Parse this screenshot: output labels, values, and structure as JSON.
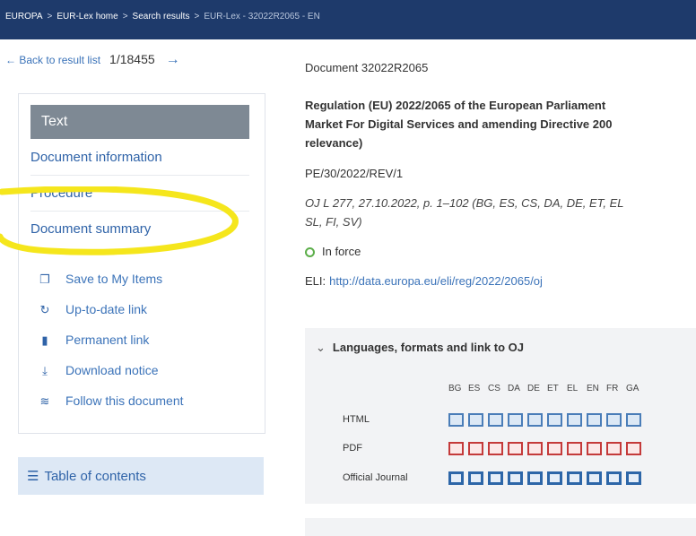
{
  "breadcrumb": {
    "items": [
      "EUROPA",
      "EUR-Lex home",
      "Search results",
      "EUR-Lex - 32022R2065 - EN"
    ],
    "separator": ">"
  },
  "nav": {
    "back_label": "Back to result list",
    "back_arrow": "←",
    "counter": "1/18455",
    "next_arrow": "→"
  },
  "sidebar": {
    "active": "Text",
    "items": [
      "Document information",
      "Procedure",
      "Document summary"
    ],
    "actions": [
      {
        "label": "Save to My Items",
        "icon": "bookmark-icon",
        "glyph": "❐"
      },
      {
        "label": "Up-to-date link",
        "icon": "refresh-icon",
        "glyph": "↻"
      },
      {
        "label": "Permanent link",
        "icon": "bookmark-flag-icon",
        "glyph": "▮"
      },
      {
        "label": "Download notice",
        "icon": "download-icon",
        "glyph": "⤓"
      },
      {
        "label": "Follow this document",
        "icon": "rss-icon",
        "glyph": "≋"
      }
    ],
    "toc_label": "Table of contents",
    "toc_glyph": "☰"
  },
  "document": {
    "id_label": "Document 32022R2065",
    "title_lines": [
      "Regulation (EU) 2022/2065 of the European Parliament",
      "Market For Digital Services and amending Directive 200",
      "relevance)"
    ],
    "reference": "PE/30/2022/REV/1",
    "oj_lines": [
      "OJ L 277, 27.10.2022, p. 1–102 (BG, ES, CS, DA, DE, ET, EL",
      "SL, FI, SV)"
    ],
    "status": "In force",
    "eli_label": "ELI:",
    "eli_link": "http://data.europa.eu/eli/reg/2022/2065/oj"
  },
  "languages": {
    "header": "Languages, formats and link to OJ",
    "chevron": "⌄",
    "codes": [
      "BG",
      "ES",
      "CS",
      "DA",
      "DE",
      "ET",
      "EL",
      "EN",
      "FR",
      "GA"
    ],
    "rows": [
      "HTML",
      "PDF",
      "Official Journal"
    ]
  },
  "colors": {
    "topbar": "#1e3a6b",
    "link": "#3b73b9",
    "active_nav": "#7e8994",
    "highlight": "#f5e61c",
    "status_green": "#5cae4a"
  }
}
